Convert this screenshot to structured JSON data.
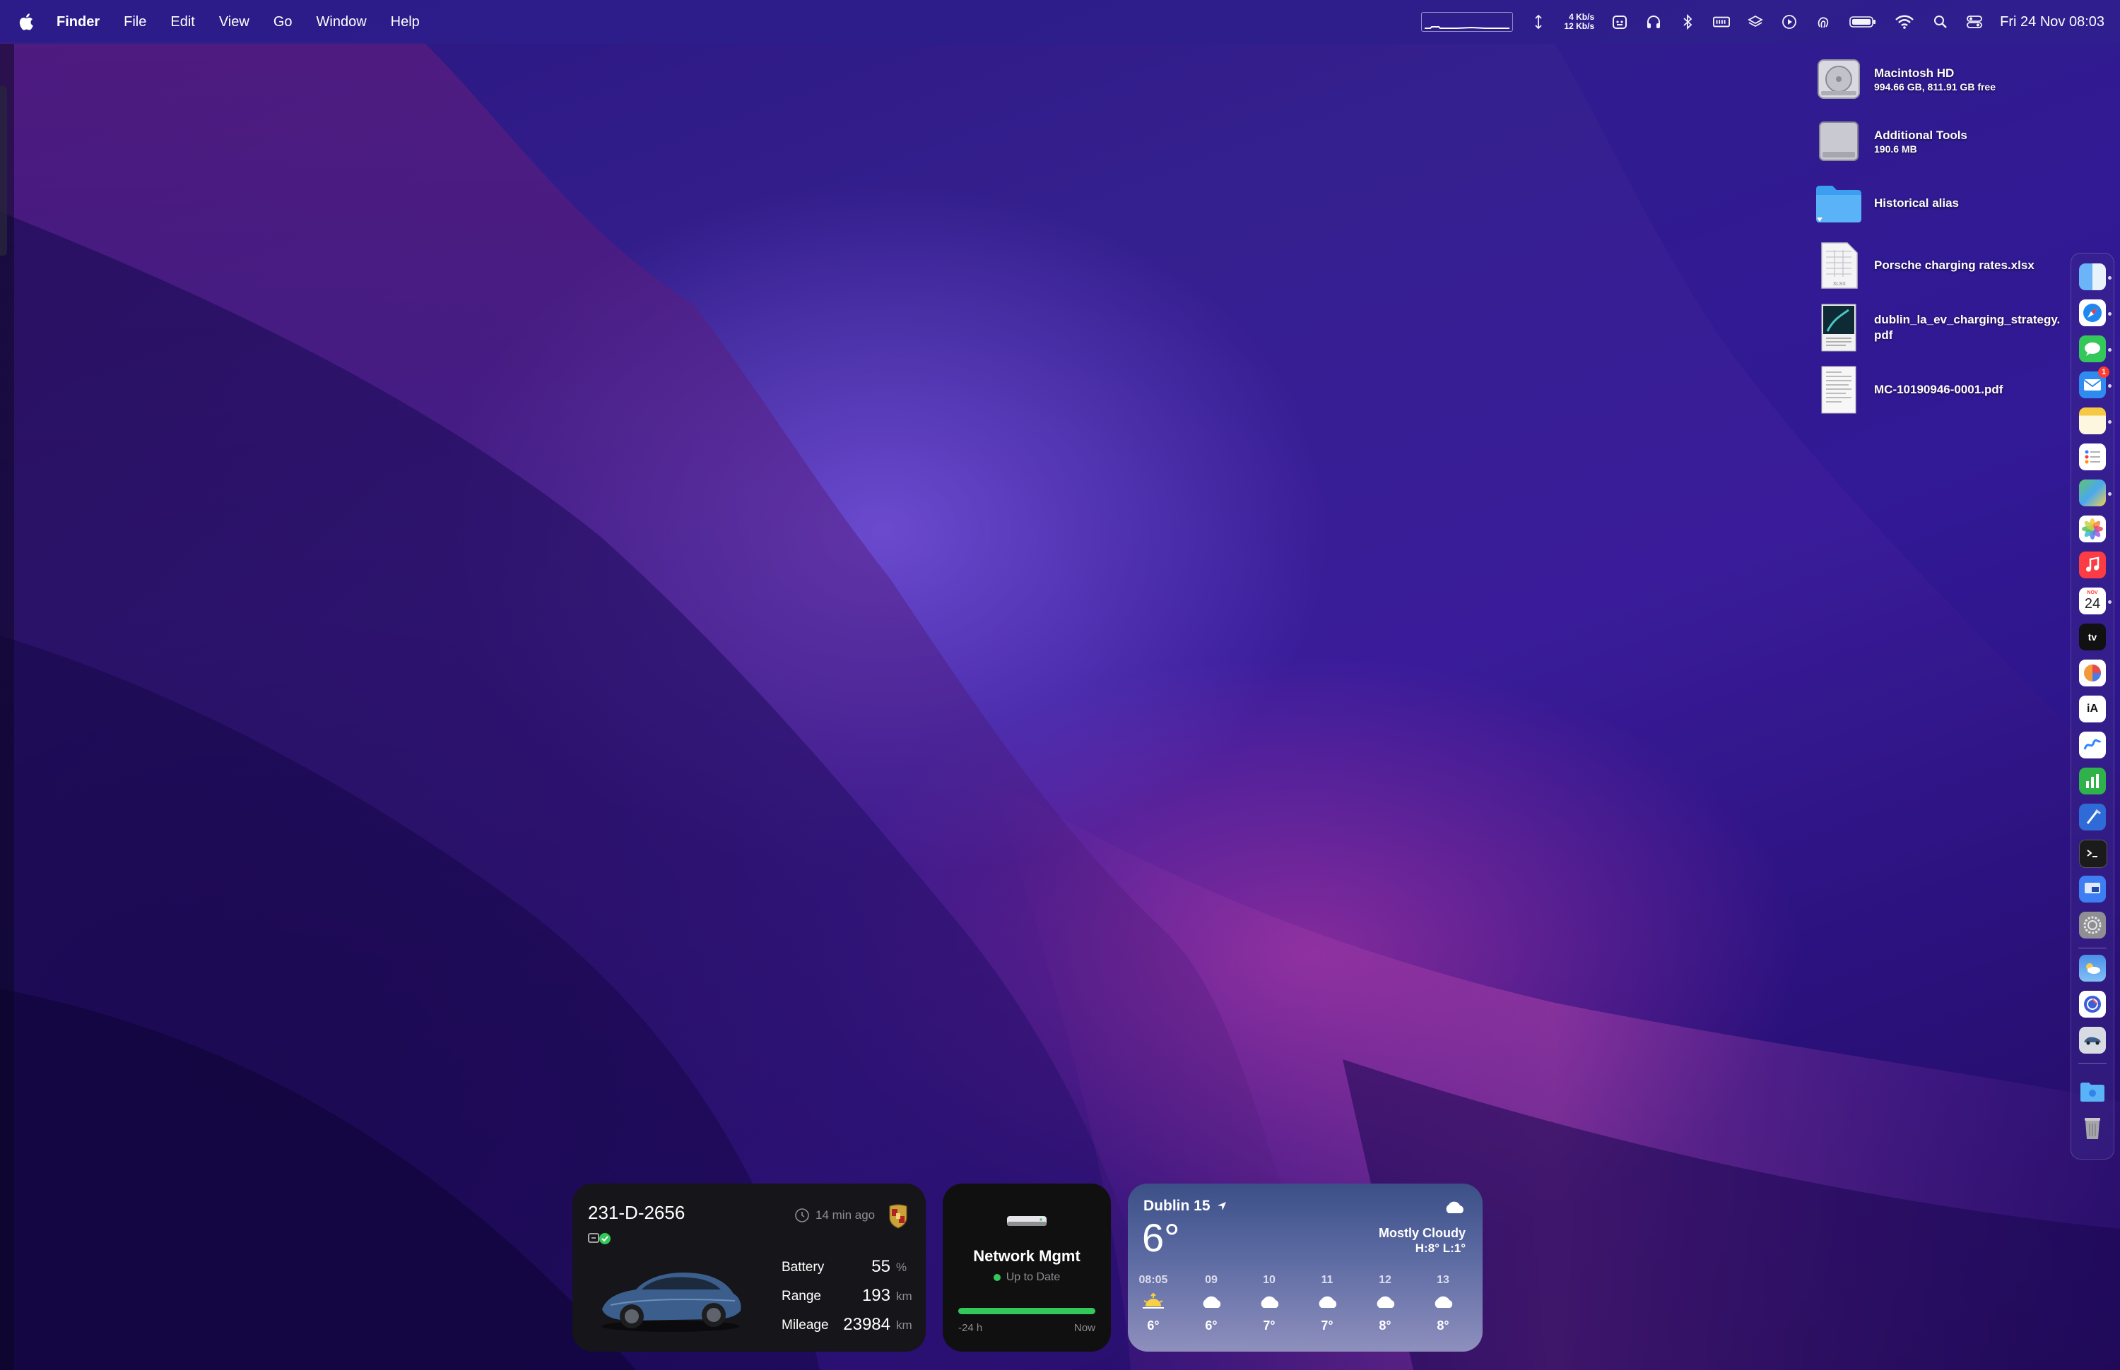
{
  "menubar": {
    "app": "Finder",
    "items": [
      "File",
      "Edit",
      "View",
      "Go",
      "Window",
      "Help"
    ],
    "net_up": "4 Kb/s",
    "net_down": "12 Kb/s",
    "clock": "Fri 24 Nov  08:03"
  },
  "desktop": {
    "items": [
      {
        "name": "Macintosh HD",
        "detail": "994.66 GB, 811.91 GB free",
        "icon": "hard-drive-icon"
      },
      {
        "name": "Additional Tools",
        "detail": "190.6 MB",
        "icon": "disk-image-icon"
      },
      {
        "name": "Historical alias",
        "detail": "",
        "icon": "folder-icon"
      },
      {
        "name": "Porsche charging rates.xlsx",
        "detail": "",
        "icon": "spreadsheet-icon"
      },
      {
        "name": "dublin_la_ev_charging_strategy.pdf",
        "detail": "",
        "icon": "pdf-icon"
      },
      {
        "name": "MC-10190946-0001.pdf",
        "detail": "",
        "icon": "pdf-icon"
      }
    ]
  },
  "dock": {
    "badge": "1",
    "calendar_day": "24",
    "calendar_month": "NOV",
    "tv_label": "tv",
    "ia_label": "iA"
  },
  "car_widget": {
    "plate": "231-D-2656",
    "updated": "14 min ago",
    "battery_label": "Battery",
    "battery_value": "55",
    "battery_unit": "%",
    "range_label": "Range",
    "range_value": "193",
    "range_unit": "km",
    "mileage_label": "Mileage",
    "mileage_value": "23984",
    "mileage_unit": "km",
    "battery_level": 0.55
  },
  "network_widget": {
    "title": "Network Mgmt",
    "status": "Up to Date",
    "start_label": "-24 h",
    "end_label": "Now",
    "status_color": "#34c759"
  },
  "weather_widget": {
    "location": "Dublin 15",
    "temp": "6°",
    "condition": "Mostly Cloudy",
    "high_low": "H:8° L:1°",
    "hours": [
      {
        "time": "08:05",
        "temp": "6°",
        "icon": "sunrise-icon"
      },
      {
        "time": "09",
        "temp": "6°",
        "icon": "cloud-icon"
      },
      {
        "time": "10",
        "temp": "7°",
        "icon": "cloud-icon"
      },
      {
        "time": "11",
        "temp": "7°",
        "icon": "cloud-icon"
      },
      {
        "time": "12",
        "temp": "8°",
        "icon": "cloud-icon"
      },
      {
        "time": "13",
        "temp": "8°",
        "icon": "cloud-icon"
      }
    ]
  }
}
